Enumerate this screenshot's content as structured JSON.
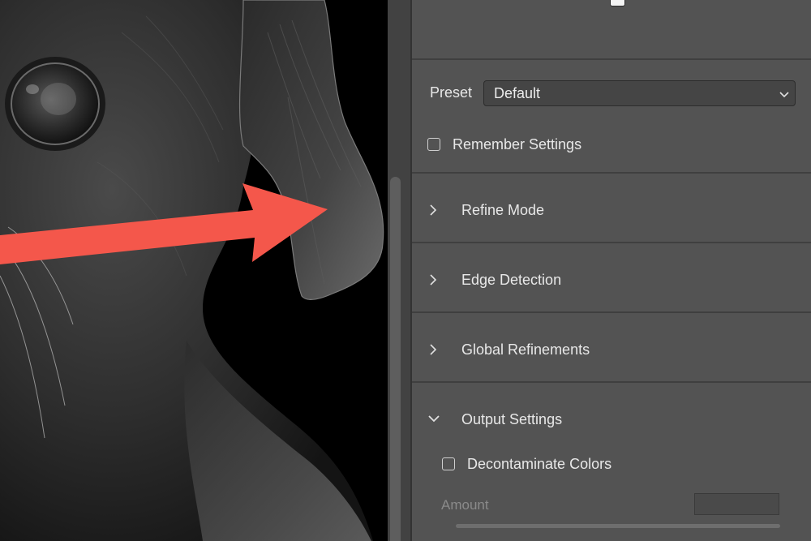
{
  "panel": {
    "preset_label": "Preset",
    "preset_value": "Default",
    "remember_settings_label": "Remember Settings",
    "remember_settings_checked": false,
    "sections": [
      {
        "label": "Refine Mode",
        "expanded": false
      },
      {
        "label": "Edge Detection",
        "expanded": false
      },
      {
        "label": "Global Refinements",
        "expanded": false
      },
      {
        "label": "Output Settings",
        "expanded": true
      }
    ],
    "output_settings": {
      "decontaminate_label": "Decontaminate Colors",
      "decontaminate_checked": false,
      "amount_label": "Amount",
      "amount_value": ""
    }
  },
  "icons": {
    "collapsed": "chevron-right-icon",
    "expanded": "chevron-down-icon",
    "dropdown": "chevron-down-icon"
  },
  "colors": {
    "panel_bg": "#535353",
    "canvas_bg": "#000000",
    "annotation_arrow": "#f4574b",
    "text": "#e8e8e8",
    "disabled_text": "#8a8a8a"
  }
}
